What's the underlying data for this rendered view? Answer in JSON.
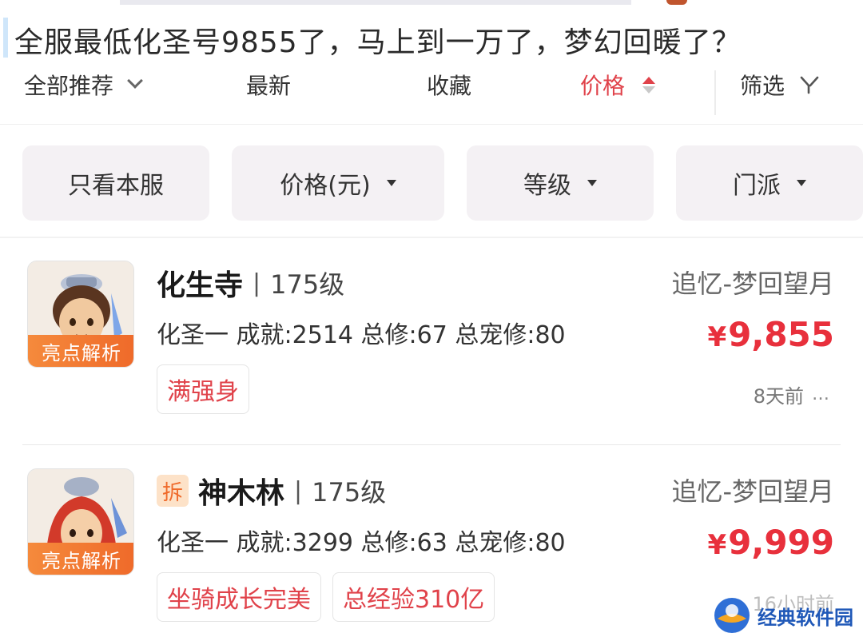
{
  "title": "全服最低化圣号9855了，马上到一万了，梦幻回暖了？",
  "sort_tabs": {
    "all": "全部推荐",
    "newest": "最新",
    "favorites": "收藏",
    "price": "价格",
    "filter": "筛选"
  },
  "filters": {
    "server_only": "只看本服",
    "price": "价格(元)",
    "level": "等级",
    "school": "门派"
  },
  "listings": [
    {
      "avatar_tag": "亮点解析",
      "split_badge": "",
      "school": "化生寺",
      "level": "175级",
      "server": "追忆-梦回望月",
      "stats": "化圣一 成就:2514 总修:67 总宠修:80",
      "price": "9,855",
      "tags": [
        "满强身"
      ],
      "time": "8天前"
    },
    {
      "avatar_tag": "亮点解析",
      "split_badge": "拆",
      "school": "神木林",
      "level": "175级",
      "server": "追忆-梦回望月",
      "stats": "化圣一 成就:3299 总修:63 总宠修:80",
      "price": "9,999",
      "tags": [
        "坐骑成长完美",
        "总经验310亿"
      ],
      "time": "16小时前"
    }
  ],
  "currency_symbol": "¥",
  "separator": "|",
  "more_icon": "…",
  "watermark": "经典软件园",
  "colors": {
    "accent_red": "#e0424a",
    "price_red": "#e8303c",
    "tag_orange": "#ef6a2a",
    "chip_bg": "#f4f1f4"
  }
}
